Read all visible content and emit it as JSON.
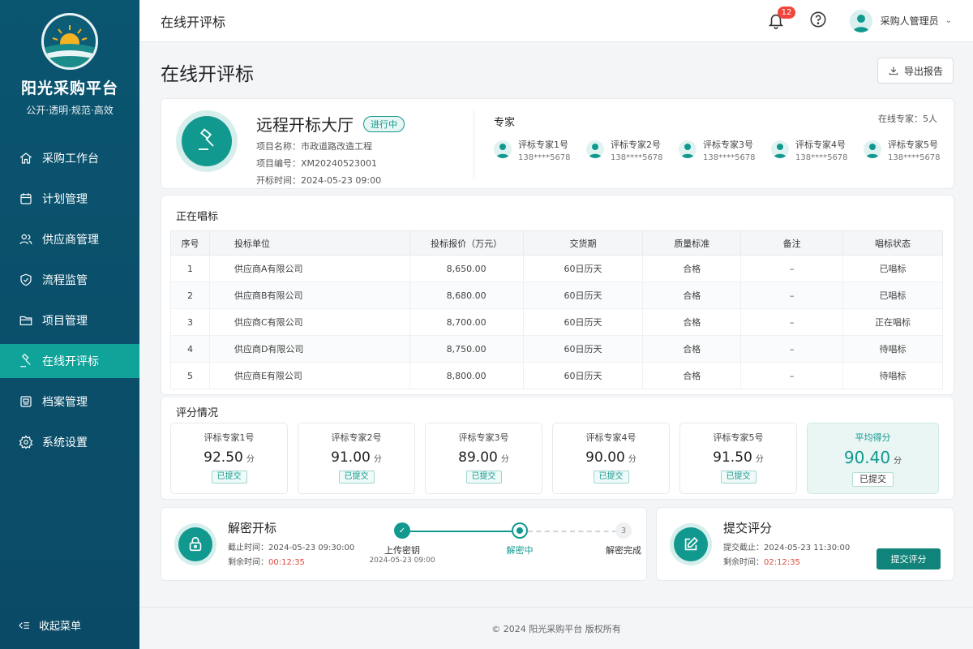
{
  "brand": {
    "name": "阳光采购平台",
    "slogan": "公开·透明·规范·高效"
  },
  "sidebar": {
    "items": [
      {
        "label": "采购工作台",
        "icon": "home-icon"
      },
      {
        "label": "计划管理",
        "icon": "calendar-icon"
      },
      {
        "label": "供应商管理",
        "icon": "users-icon"
      },
      {
        "label": "流程监管",
        "icon": "shield-icon"
      },
      {
        "label": "项目管理",
        "icon": "folder-icon"
      },
      {
        "label": "在线开评标",
        "icon": "gavel-icon",
        "active": true
      },
      {
        "label": "档案管理",
        "icon": "archive-icon"
      },
      {
        "label": "系统设置",
        "icon": "gear-icon"
      }
    ],
    "collapse_label": "收起菜单"
  },
  "header": {
    "title": "在线开评标",
    "notification_count": "12",
    "user_name": "采购人管理员",
    "caret": "⌄"
  },
  "main": {
    "title": "在线开评标",
    "export_label": "导出报告",
    "hall": {
      "name": "远程开标大厅",
      "status": "进行中",
      "project_name": "项目名称：市政道路改造工程",
      "project_code": "项目编号：XM20240523001",
      "open_time": "开标时间：2024-05-23 09:00",
      "experts_title": "专家",
      "experts_online": "在线专家：5人",
      "experts": [
        {
          "name": "评标专家1号",
          "phone": "138****5678"
        },
        {
          "name": "评标专家2号",
          "phone": "138****5678"
        },
        {
          "name": "评标专家3号",
          "phone": "138****5678"
        },
        {
          "name": "评标专家4号",
          "phone": "138****5678"
        },
        {
          "name": "评标专家5号",
          "phone": "138****5678"
        }
      ]
    },
    "bids": {
      "title": "正在唱标",
      "columns": [
        "序号",
        "投标单位",
        "投标报价（万元）",
        "交货期",
        "质量标准",
        "备注",
        "唱标状态"
      ],
      "rows": [
        {
          "no": "1",
          "company": "供应商A有限公司",
          "price": "8,650.00",
          "delivery": "60日历天",
          "quality": "合格",
          "note": "–",
          "status": "已唱标",
          "state": "done"
        },
        {
          "no": "2",
          "company": "供应商B有限公司",
          "price": "8,680.00",
          "delivery": "60日历天",
          "quality": "合格",
          "note": "–",
          "status": "已唱标",
          "state": "done"
        },
        {
          "no": "3",
          "company": "供应商C有限公司",
          "price": "8,700.00",
          "delivery": "60日历天",
          "quality": "合格",
          "note": "–",
          "status": "正在唱标",
          "state": "now"
        },
        {
          "no": "4",
          "company": "供应商D有限公司",
          "price": "8,750.00",
          "delivery": "60日历天",
          "quality": "合格",
          "note": "–",
          "status": "待唱标",
          "state": "wait"
        },
        {
          "no": "5",
          "company": "供应商E有限公司",
          "price": "8,800.00",
          "delivery": "60日历天",
          "quality": "合格",
          "note": "–",
          "status": "待唱标",
          "state": "wait"
        }
      ]
    },
    "scores": {
      "title": "评分情况",
      "unit": "分",
      "items": [
        {
          "name": "评标专家1号",
          "score": "92.50",
          "status": "已提交"
        },
        {
          "name": "评标专家2号",
          "score": "91.00",
          "status": "已提交"
        },
        {
          "name": "评标专家3号",
          "score": "89.00",
          "status": "已提交"
        },
        {
          "name": "评标专家4号",
          "score": "90.00",
          "status": "已提交"
        },
        {
          "name": "评标专家5号",
          "score": "91.50",
          "status": "已提交"
        }
      ],
      "average": {
        "name": "平均得分",
        "score": "90.40",
        "status": "已提交"
      }
    },
    "decrypt": {
      "title": "解密开标",
      "deadline_label": "截止时间：",
      "deadline": "2024-05-23 09:30:00",
      "remain_label": "剩余时间：",
      "remain": "00:12:35",
      "steps": [
        {
          "label": "上传密钥",
          "sub": "2024-05-23 09:00",
          "state": "done",
          "num": ""
        },
        {
          "label": "解密中",
          "sub": "",
          "state": "current",
          "num": ""
        },
        {
          "label": "解密完成",
          "sub": "",
          "state": "todo",
          "num": "3"
        }
      ]
    },
    "submit": {
      "title": "提交评分",
      "deadline_label": "提交截止：",
      "deadline": "2024-05-23 11:30:00",
      "remain_label": "剩余时间：",
      "remain": "02:12:35",
      "button": "提交评分"
    }
  },
  "footer": "© 2024  阳光采购平台  版权所有",
  "colors": {
    "sidebar": "#0b4f6b",
    "accent": "#12998f",
    "active": "#10a39a",
    "link_blue": "#1b6fd1",
    "danger": "#e24a3b"
  }
}
